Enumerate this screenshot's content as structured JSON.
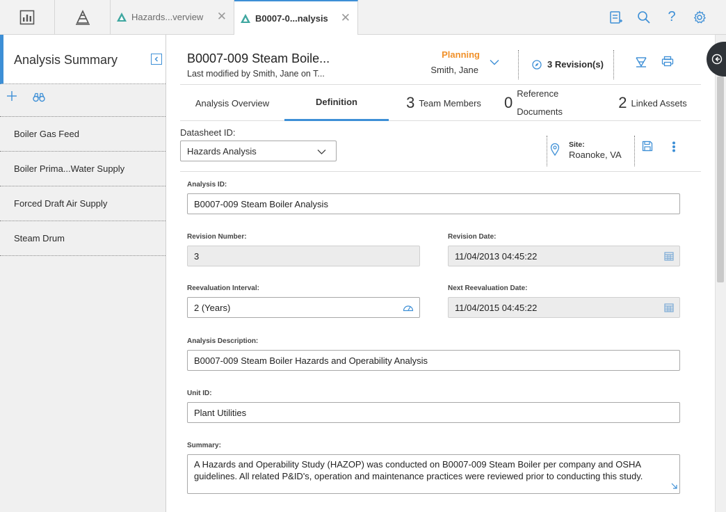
{
  "app_tabs": [
    {
      "label": "Hazards...verview",
      "active": false
    },
    {
      "label": "B0007-0...nalysis",
      "active": true
    }
  ],
  "sidebar": {
    "title": "Analysis Summary",
    "items": [
      {
        "label": "Boiler Gas Feed"
      },
      {
        "label": "Boiler Prima...Water Supply"
      },
      {
        "label": "Forced Draft Air Supply"
      },
      {
        "label": "Steam Drum"
      }
    ]
  },
  "header": {
    "title": "B0007-009 Steam Boile...",
    "subtitle": "Last modified by Smith, Jane on T...",
    "state": "Planning",
    "state_user": "Smith, Jane",
    "revisions": "3 Revision(s)"
  },
  "tabs": {
    "overview": "Analysis Overview",
    "definition": "Definition",
    "team_count": "3",
    "team_label": "Team Members",
    "ref_count": "0",
    "ref_label_1": "Reference",
    "ref_label_2": "Documents",
    "assets_count": "2",
    "assets_label": "Linked Assets"
  },
  "datasheet": {
    "label": "Datasheet ID:",
    "value": "Hazards Analysis",
    "site_label": "Site:",
    "site_value": "Roanoke, VA"
  },
  "form": {
    "analysis_id_label": "Analysis ID:",
    "analysis_id": "B0007-009 Steam Boiler Analysis",
    "revision_number_label": "Revision Number:",
    "revision_number": "3",
    "revision_date_label": "Revision Date:",
    "revision_date": "11/04/2013 04:45:22",
    "reeval_interval_label": "Reevaluation Interval:",
    "reeval_interval": "2 (Years)",
    "next_reeval_label": "Next Reevaluation Date:",
    "next_reeval": "11/04/2015 04:45:22",
    "description_label": "Analysis Description:",
    "description": "B0007-009 Steam Boiler Hazards and Operability Analysis",
    "unit_id_label": "Unit ID:",
    "unit_id": "Plant Utilities",
    "summary_label": "Summary:",
    "summary": "A Hazards and Operability Study (HAZOP) was conducted on B0007-009 Steam Boiler per company and OSHA guidelines. All related P&ID's, operation and maintenance practices were reviewed prior to conducting this study."
  },
  "colors": {
    "accent": "#3d8fd6",
    "state": "#f0912b"
  }
}
